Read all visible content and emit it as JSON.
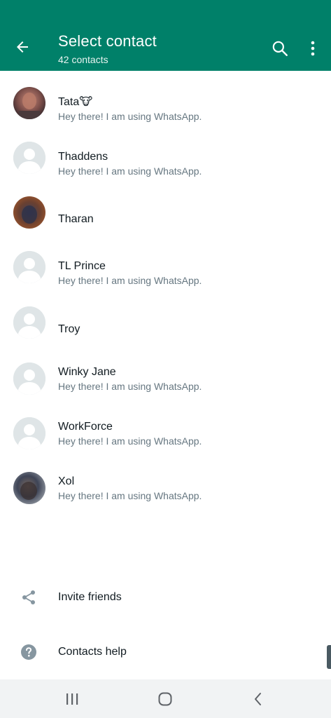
{
  "header": {
    "title": "Select contact",
    "subtitle": "42 contacts",
    "back_icon": "arrow-left-icon",
    "search_icon": "search-icon",
    "more_icon": "more-vertical-icon"
  },
  "contacts": [
    {
      "name": "Tata🐮",
      "status": "Hey there! I am using WhatsApp.",
      "avatar": "photo"
    },
    {
      "name": "Thaddens",
      "status": "Hey there! I am using WhatsApp.",
      "avatar": "default"
    },
    {
      "name": "Tharan",
      "status": "",
      "avatar": "photo"
    },
    {
      "name": "TL Prince",
      "status": "Hey there! I am using WhatsApp.",
      "avatar": "default"
    },
    {
      "name": "Troy",
      "status": "",
      "avatar": "default"
    },
    {
      "name": "Winky Jane",
      "status": "Hey there! I am using WhatsApp.",
      "avatar": "default"
    },
    {
      "name": "WorkForce",
      "status": "Hey there! I am using WhatsApp.",
      "avatar": "default"
    },
    {
      "name": "Xol",
      "status": "Hey there! I am using WhatsApp.",
      "avatar": "photo"
    }
  ],
  "actions": {
    "invite": {
      "label": "Invite friends",
      "icon": "share-icon"
    },
    "help": {
      "label": "Contacts help",
      "icon": "help-icon"
    }
  },
  "navbar": {
    "recents_icon": "recent-apps-icon",
    "home_icon": "home-icon",
    "back_icon": "back-icon"
  },
  "colors": {
    "header_bg": "#008069",
    "name_text": "#111b21",
    "status_text": "#667781",
    "default_avatar_bg": "#dfe5e7"
  }
}
